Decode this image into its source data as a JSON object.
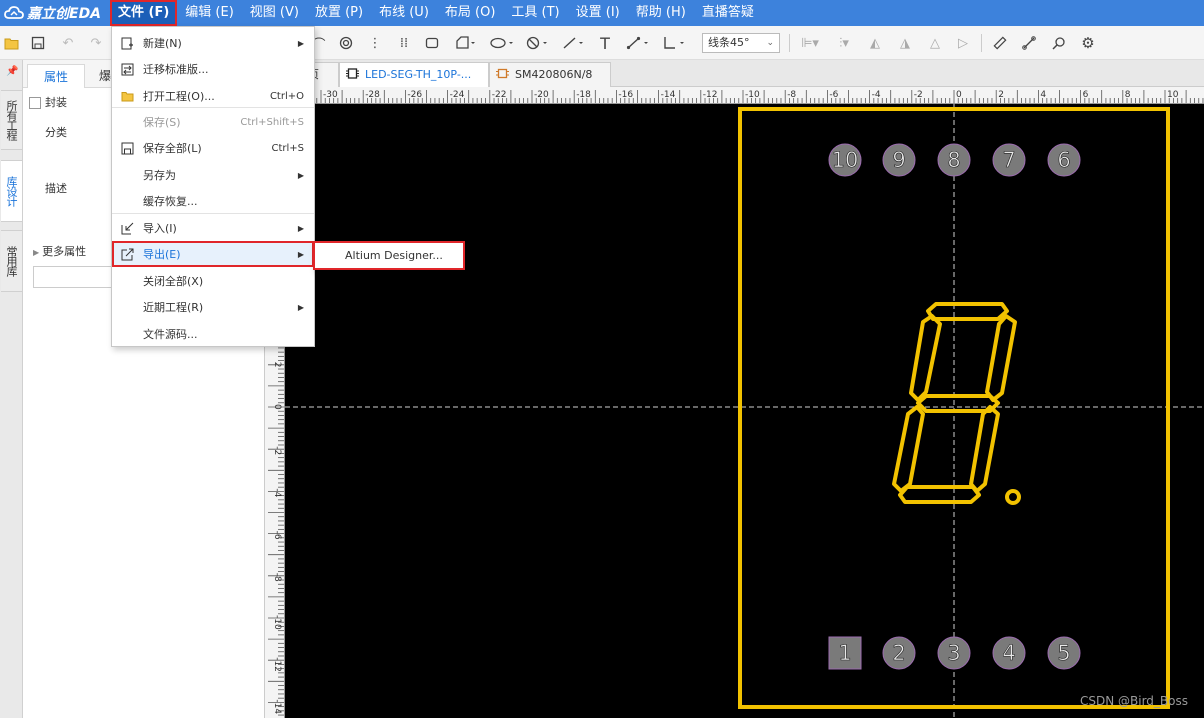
{
  "app": {
    "logo_text": "嘉立创EDA"
  },
  "menubar": {
    "items": [
      "文件 (F)",
      "编辑 (E)",
      "视图 (V)",
      "放置 (P)",
      "布线 (U)",
      "布局 (O)",
      "工具 (T)",
      "设置 (I)",
      "帮助 (H)",
      "直播答疑"
    ]
  },
  "toolbar": {
    "line_mode": "线条45°"
  },
  "left_tabs": {
    "items": [
      "所有工程",
      "库设计",
      "常用库"
    ]
  },
  "panel": {
    "tabs": [
      "属性",
      "爆"
    ],
    "footprint_label": "封装",
    "category_label": "分类",
    "description_label": "描述",
    "more_props_label": "更多属性"
  },
  "doc_tabs": {
    "items": [
      "页",
      "LED-SEG-TH_10P-...",
      "SM420806N/8"
    ]
  },
  "file_menu": {
    "items": [
      {
        "label": "新建(N)",
        "shortcut": "",
        "submenu": true,
        "disabled": false
      },
      {
        "label": "迁移标准版...",
        "shortcut": "",
        "submenu": false,
        "disabled": false
      },
      {
        "label": "打开工程(O)...",
        "shortcut": "Ctrl+O",
        "submenu": false,
        "disabled": false
      },
      {
        "label": "保存(S)",
        "shortcut": "Ctrl+Shift+S",
        "submenu": false,
        "disabled": true
      },
      {
        "label": "保存全部(L)",
        "shortcut": "Ctrl+S",
        "submenu": false,
        "disabled": false
      },
      {
        "label": "另存为",
        "shortcut": "",
        "submenu": true,
        "disabled": false
      },
      {
        "label": "缓存恢复...",
        "shortcut": "",
        "submenu": false,
        "disabled": false
      },
      {
        "label": "导入(I)",
        "shortcut": "",
        "submenu": true,
        "disabled": false
      },
      {
        "label": "导出(E)",
        "shortcut": "",
        "submenu": true,
        "disabled": false
      },
      {
        "label": "关闭全部(X)",
        "shortcut": "",
        "submenu": false,
        "disabled": false
      },
      {
        "label": "近期工程(R)",
        "shortcut": "",
        "submenu": true,
        "disabled": false
      },
      {
        "label": "文件源码...",
        "shortcut": "",
        "submenu": false,
        "disabled": false
      }
    ],
    "export_submenu_item": "Altium Designer..."
  },
  "ruler": {
    "h_labels": [
      "-30",
      "-28",
      "-26",
      "-24",
      "-22",
      "-20",
      "-18",
      "-16",
      "-14",
      "-12",
      "-10",
      "-8",
      "-6",
      "-4",
      "-2",
      "0",
      "2",
      "4",
      "6",
      "8",
      "10"
    ],
    "v_labels": [
      "2",
      "0",
      "-2",
      "-4",
      "-6",
      "-8",
      "-10",
      "-12",
      "-14"
    ]
  },
  "pcb": {
    "top_pins": [
      "10",
      "9",
      "8",
      "7",
      "6"
    ],
    "bottom_pins": [
      "1",
      "2",
      "3",
      "4",
      "5"
    ],
    "silkscreen_color": "#f2c200",
    "pad_color": "#7a7a7a"
  },
  "watermark": "CSDN @Bird_Boss",
  "colors": {
    "menubar": "#3d82dc",
    "highlight": "#e0262a",
    "accent": "#1a73d9"
  }
}
